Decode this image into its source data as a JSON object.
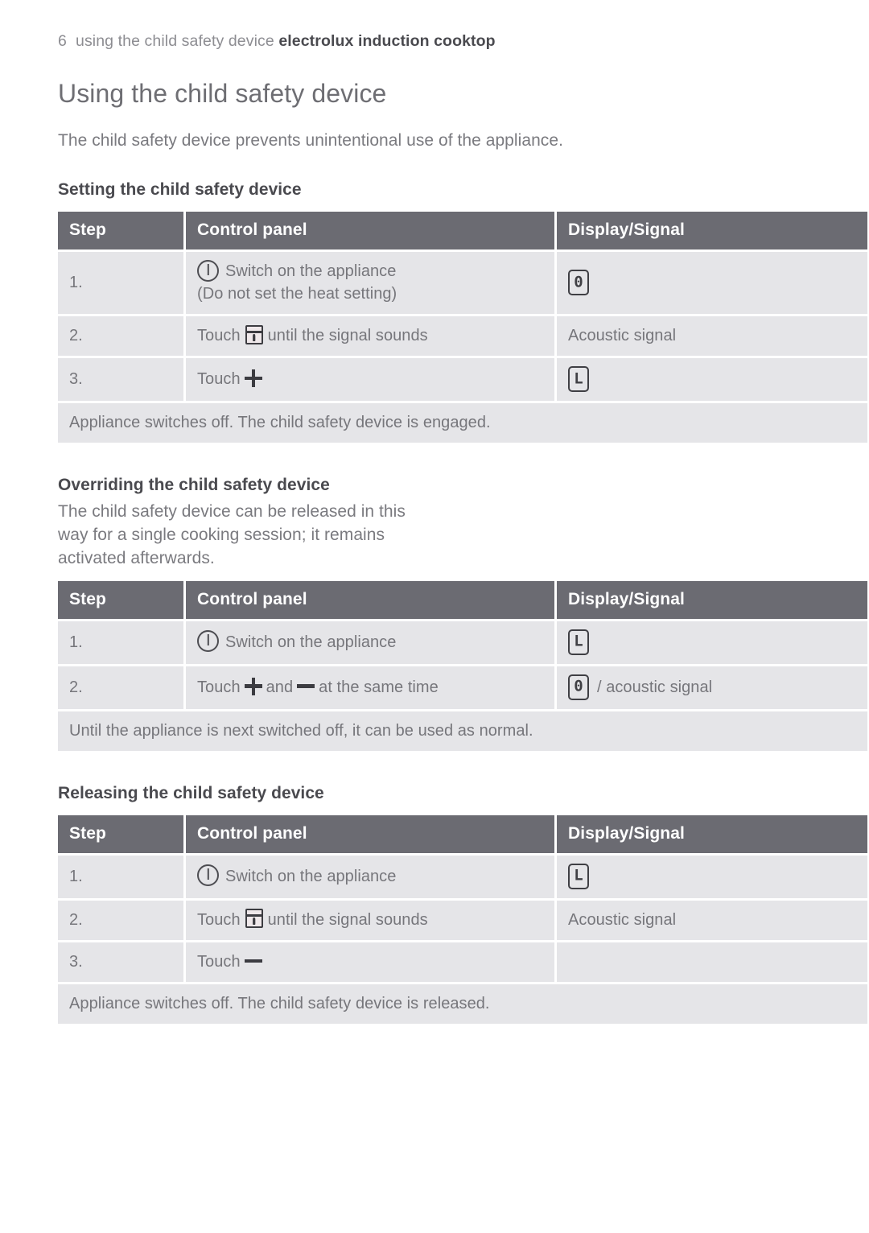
{
  "running_header": {
    "page_number": "6",
    "section": "using the child safety device",
    "brand": "electrolux induction cooktop"
  },
  "page_title": "Using the child safety device",
  "intro": "The child safety device prevents unintentional use of the appliance.",
  "colors": {
    "table_header_bg": "#6b6b72",
    "table_cell_bg": "#e5e5e8",
    "body_text": "#7a7a7f",
    "heading_text": "#6e6e73",
    "icon_dark": "#3c3c41"
  },
  "table_columns": {
    "step": "Step",
    "control_panel": "Control panel",
    "display_signal": "Display/Signal"
  },
  "sections": [
    {
      "heading": "Setting the child safety device",
      "lead": "",
      "rows": [
        {
          "step": "1.",
          "panel_icon": "power-icon",
          "panel_text": "Switch on the appliance",
          "panel_text2": "(Do not set the heat setting)",
          "display_glyph": "0",
          "display_text": ""
        },
        {
          "step": "2.",
          "panel_prefix": "Touch",
          "panel_icon": "lock-icon",
          "panel_suffix": "until the signal sounds",
          "display_glyph": "",
          "display_text": "Acoustic signal"
        },
        {
          "step": "3.",
          "panel_prefix": "Touch",
          "panel_icon": "plus-icon",
          "panel_suffix": "",
          "display_glyph": "L",
          "display_text": ""
        }
      ],
      "footnote": "Appliance switches off. The child safety device is engaged."
    },
    {
      "heading": "Overriding the child safety device",
      "lead": "The child safety device can be released in this way for a single cooking session; it remains activated afterwards.",
      "rows": [
        {
          "step": "1.",
          "panel_icon": "power-icon",
          "panel_text": "Switch on the appliance",
          "display_glyph": "L",
          "display_text": ""
        },
        {
          "step": "2.",
          "panel_prefix": "Touch",
          "panel_icon": "plus-icon",
          "panel_mid": "and",
          "panel_icon2": "minus-icon",
          "panel_suffix": "at the same time",
          "display_glyph": "0",
          "display_text": "/ acoustic signal"
        }
      ],
      "footnote": "Until the appliance is next switched off, it can be used as normal."
    },
    {
      "heading": "Releasing the child safety device",
      "lead": "",
      "rows": [
        {
          "step": "1.",
          "panel_icon": "power-icon",
          "panel_text": "Switch on the appliance",
          "display_glyph": "L",
          "display_text": ""
        },
        {
          "step": "2.",
          "panel_prefix": "Touch",
          "panel_icon": "lock-icon",
          "panel_suffix": "until the signal sounds",
          "display_glyph": "",
          "display_text": "Acoustic signal"
        },
        {
          "step": "3.",
          "panel_prefix": "Touch",
          "panel_icon": "minus-icon",
          "panel_suffix": "",
          "display_glyph": "",
          "display_text": ""
        }
      ],
      "footnote": "Appliance switches off. The child safety device is released."
    }
  ]
}
